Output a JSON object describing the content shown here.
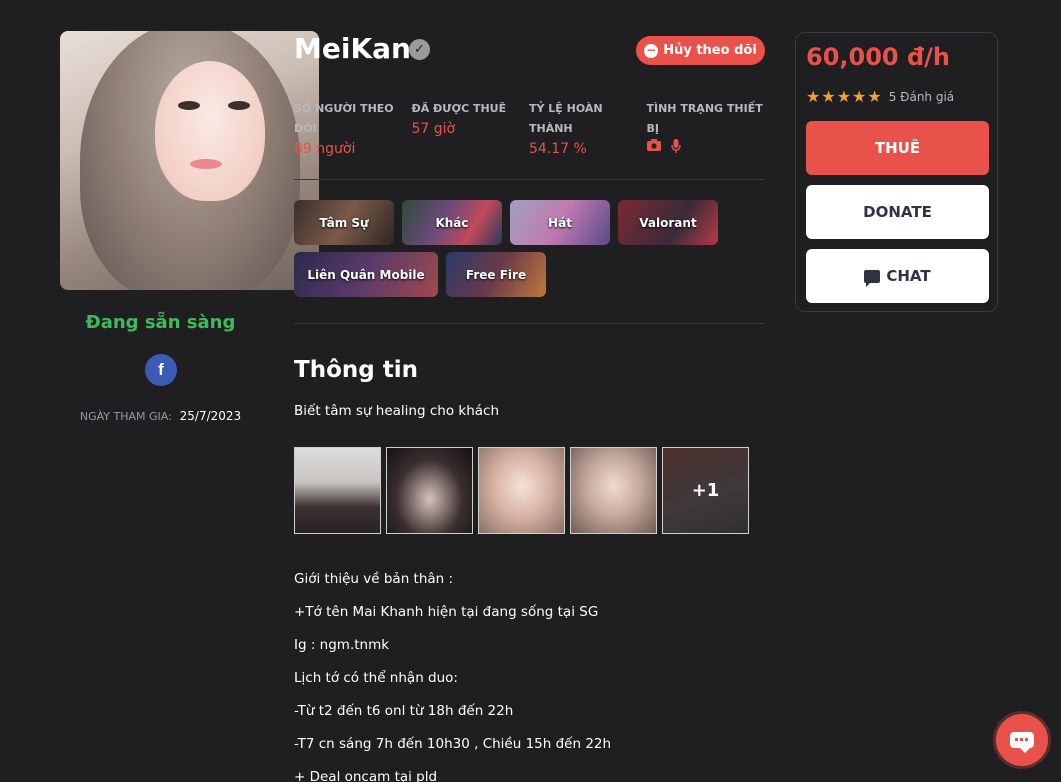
{
  "profile": {
    "name": "MeiKan",
    "status": "Đang sẵn sàng",
    "join_label": "NGÀY THAM GIA:",
    "join_date": "25/7/2023"
  },
  "header": {
    "unfollow_label": "Hủy theo dõi"
  },
  "stats": [
    {
      "label": "SỐ NGƯỜI THEO DÕI",
      "value": "89 người"
    },
    {
      "label": "ĐÃ ĐƯỢC THUÊ",
      "value": "57 giờ"
    },
    {
      "label": "TỶ LỆ HOÀN THÀNH",
      "value": "54.17 %"
    },
    {
      "label": "TÌNH TRẠNG THIẾT BỊ",
      "icons": [
        "camera-icon",
        "microphone-icon"
      ]
    }
  ],
  "games": [
    "Tâm Sự",
    "Khác",
    "Hát",
    "Valorant",
    "Liên Quân Mobile",
    "Free Fire"
  ],
  "info": {
    "title": "Thông tin",
    "bio": "Biết tâm sự healing cho khách",
    "more_photos": "+1",
    "intro_lines": [
      "Giới thiệu về bản thân :",
      "+Tớ tên Mai Khanh hiện tại đang sống tại SG",
      "Ig : ngm.tnmk",
      "Lịch tớ có thể nhận duo:",
      "-Từ t2 đến t6 onl từ 18h đến 22h",
      "-T7 cn sáng 7h đến 10h30 , Chiều 15h đến 22h",
      "+ Deal oncam tại pld"
    ]
  },
  "card": {
    "price": "60,000 đ/h",
    "stars": 5,
    "review_count": "5 Đánh giá",
    "rent_label": "THUÊ",
    "donate_label": "DONATE",
    "chat_label": "CHAT"
  },
  "colors": {
    "accent": "#e9524a",
    "ready": "#3fb95a",
    "background": "#1f1f22",
    "star": "#f0a030"
  }
}
